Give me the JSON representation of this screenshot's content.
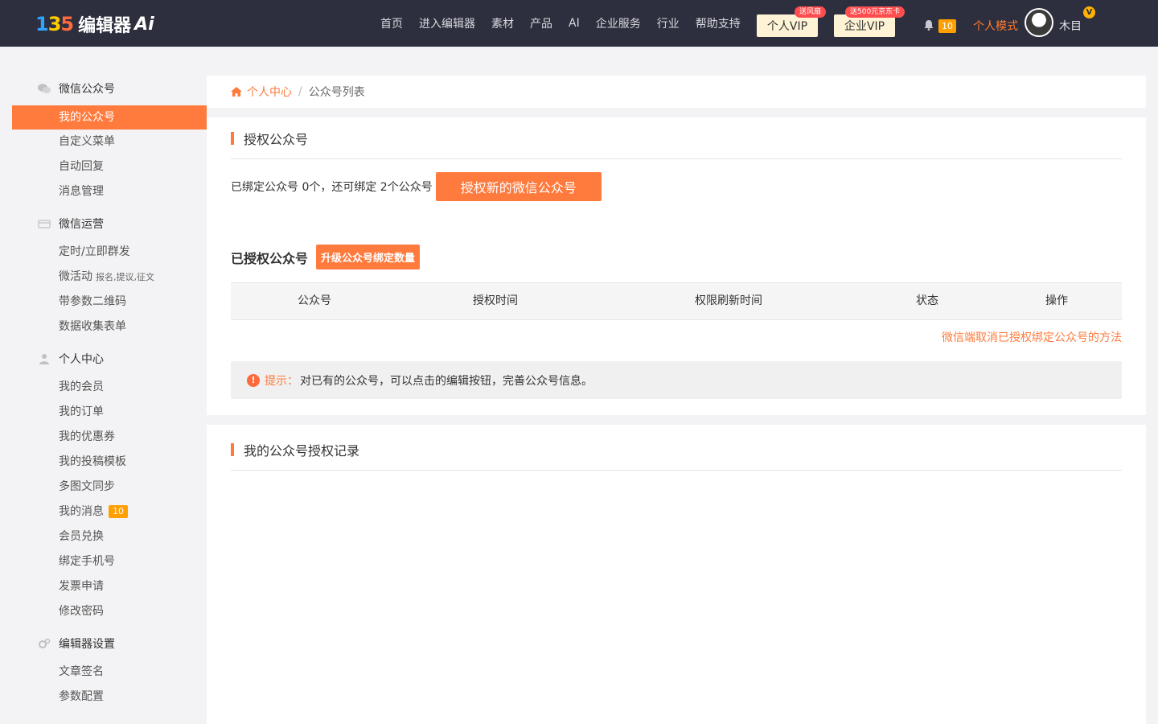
{
  "header": {
    "logo_mark_1": "1",
    "logo_mark_2": "3",
    "logo_mark_3": "5",
    "logo_text": "编辑器",
    "logo_ai": "Ai",
    "nav": [
      "首页",
      "进入编辑器",
      "素材",
      "产品",
      "AI",
      "企业服务",
      "行业",
      "帮助支持"
    ],
    "vip_personal": "个人VIP",
    "vip_personal_tag": "送风扇",
    "vip_company": "企业VIP",
    "vip_company_tag": "送500元京东卡",
    "notify_count": "10",
    "mode": "个人模式",
    "vip_badge": "V",
    "username": "木目"
  },
  "sidebar": {
    "groups": [
      {
        "label": "微信公众号",
        "icon": "wechat-icon"
      },
      {
        "label": "微信运营",
        "icon": "card-icon"
      },
      {
        "label": "个人中心",
        "icon": "user-icon"
      },
      {
        "label": "编辑器设置",
        "icon": "gears-icon"
      }
    ],
    "items": [
      "我的公众号",
      "自定义菜单",
      "自动回复",
      "消息管理",
      "定时/立即群发",
      "微活动",
      "带参数二维码",
      "数据收集表单",
      "我的会员",
      "我的订单",
      "我的优惠券",
      "我的投稿模板",
      "多图文同步",
      "我的消息",
      "会员兑换",
      "绑定手机号",
      "发票申请",
      "修改密码",
      "文章签名",
      "参数配置"
    ],
    "micro_sub": "报名,提议,征文",
    "message_badge": "10"
  },
  "breadcrumb": {
    "home": "个人中心",
    "sep": "/",
    "current": "公众号列表"
  },
  "auth": {
    "title": "授权公众号",
    "bind_text": "已绑定公众号 0个，还可绑定 2个公众号",
    "auth_button": "授权新的微信公众号",
    "authed_title": "已授权公众号",
    "upgrade_button": "升级公众号绑定数量",
    "columns": [
      "公众号",
      "授权时间",
      "权限刷新时间",
      "状态",
      "操作"
    ],
    "cancel_link": "微信端取消已授权绑定公众号的方法",
    "tip_label": "提示：",
    "tip_text": "对已有的公众号，可以点击的编辑按钮，完善公众号信息。"
  },
  "records": {
    "title": "我的公众号授权记录"
  },
  "colors": {
    "accent": "#ff7a3d",
    "topbar": "#2d2f3e",
    "badge": "#ff9f00"
  }
}
